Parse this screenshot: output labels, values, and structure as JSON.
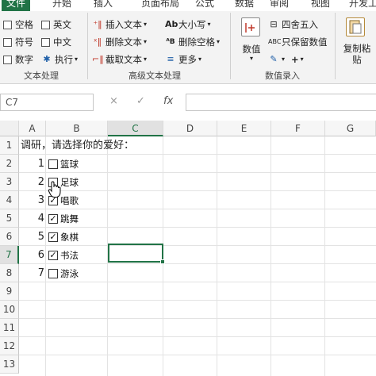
{
  "tabs": [
    "文件",
    "开始",
    "插入",
    "页面布局",
    "公式",
    "数据",
    "审阅",
    "视图",
    "开发工"
  ],
  "ribbon": {
    "text_group": {
      "items": [
        "空格",
        "英文",
        "符号",
        "中文",
        "数字",
        "执行"
      ],
      "label": "文本处理"
    },
    "advanced_group": {
      "items": [
        "插入文本",
        "大小写",
        "删除文本",
        "删除空格",
        "截取文本",
        "更多"
      ],
      "label": "高级文本处理"
    },
    "number_group": {
      "items": [
        "四舍五入",
        "只保留数值"
      ],
      "big_button": "数值",
      "label": "数值录入"
    },
    "copy_group": {
      "line1": "复制粘",
      "line2": "贴"
    }
  },
  "formula_bar": {
    "cell_ref": "C7",
    "cancel": "×",
    "confirm": "✓",
    "fx": "fx",
    "value": ""
  },
  "sheet": {
    "columns": [
      "A",
      "B",
      "C",
      "D",
      "E",
      "F",
      "G"
    ],
    "rows": [
      "1",
      "2",
      "3",
      "4",
      "5",
      "6",
      "7",
      "8",
      "9",
      "10",
      "11",
      "12",
      "13"
    ],
    "title": "调研，请选择你的爱好：",
    "items": [
      {
        "num": "1",
        "label": "篮球",
        "checked": false
      },
      {
        "num": "2",
        "label": "足球",
        "checked": false
      },
      {
        "num": "3",
        "label": "唱歌",
        "checked": true
      },
      {
        "num": "4",
        "label": "跳舞",
        "checked": true
      },
      {
        "num": "5",
        "label": "象棋",
        "checked": true
      },
      {
        "num": "6",
        "label": "书法",
        "checked": true
      },
      {
        "num": "7",
        "label": "游泳",
        "checked": false
      }
    ],
    "check_mark": "✓",
    "accent": "#217346"
  }
}
